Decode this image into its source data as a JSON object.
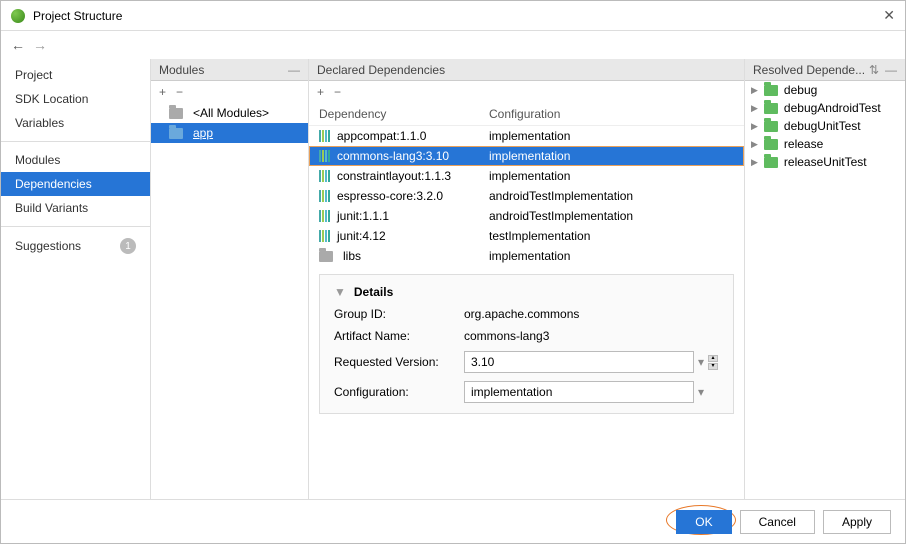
{
  "window": {
    "title": "Project Structure"
  },
  "sidebar": {
    "groups": [
      [
        "Project",
        "SDK Location",
        "Variables"
      ],
      [
        "Modules",
        "Dependencies",
        "Build Variants"
      ],
      [
        "Suggestions"
      ]
    ],
    "selected": "Dependencies",
    "suggestions_badge": "1"
  },
  "modules_panel": {
    "title": "Modules",
    "items": [
      {
        "label": "<All Modules>",
        "selected": false,
        "gray": true
      },
      {
        "label": "app",
        "selected": true,
        "gray": false
      }
    ]
  },
  "deps_panel": {
    "title": "Declared Dependencies",
    "columns": [
      "Dependency",
      "Configuration"
    ],
    "rows": [
      {
        "name": "appcompat:1.1.0",
        "config": "implementation",
        "selected": false
      },
      {
        "name": "commons-lang3:3.10",
        "config": "implementation",
        "selected": true,
        "outlined": true
      },
      {
        "name": "constraintlayout:1.1.3",
        "config": "implementation",
        "selected": false
      },
      {
        "name": "espresso-core:3.2.0",
        "config": "androidTestImplementation",
        "selected": false
      },
      {
        "name": "junit:1.1.1",
        "config": "androidTestImplementation",
        "selected": false
      },
      {
        "name": "junit:4.12",
        "config": "testImplementation",
        "selected": false
      },
      {
        "name": "libs",
        "config": "implementation",
        "selected": false,
        "dir": true
      }
    ]
  },
  "details": {
    "title": "Details",
    "group_id_label": "Group ID:",
    "group_id_value": "org.apache.commons",
    "artifact_label": "Artifact Name:",
    "artifact_value": "commons-lang3",
    "version_label": "Requested Version:",
    "version_value": "3.10",
    "config_label": "Configuration:",
    "config_value": "implementation"
  },
  "resolved_panel": {
    "title": "Resolved Depende...",
    "items": [
      "debug",
      "debugAndroidTest",
      "debugUnitTest",
      "release",
      "releaseUnitTest"
    ]
  },
  "footer": {
    "ok": "OK",
    "cancel": "Cancel",
    "apply": "Apply"
  }
}
